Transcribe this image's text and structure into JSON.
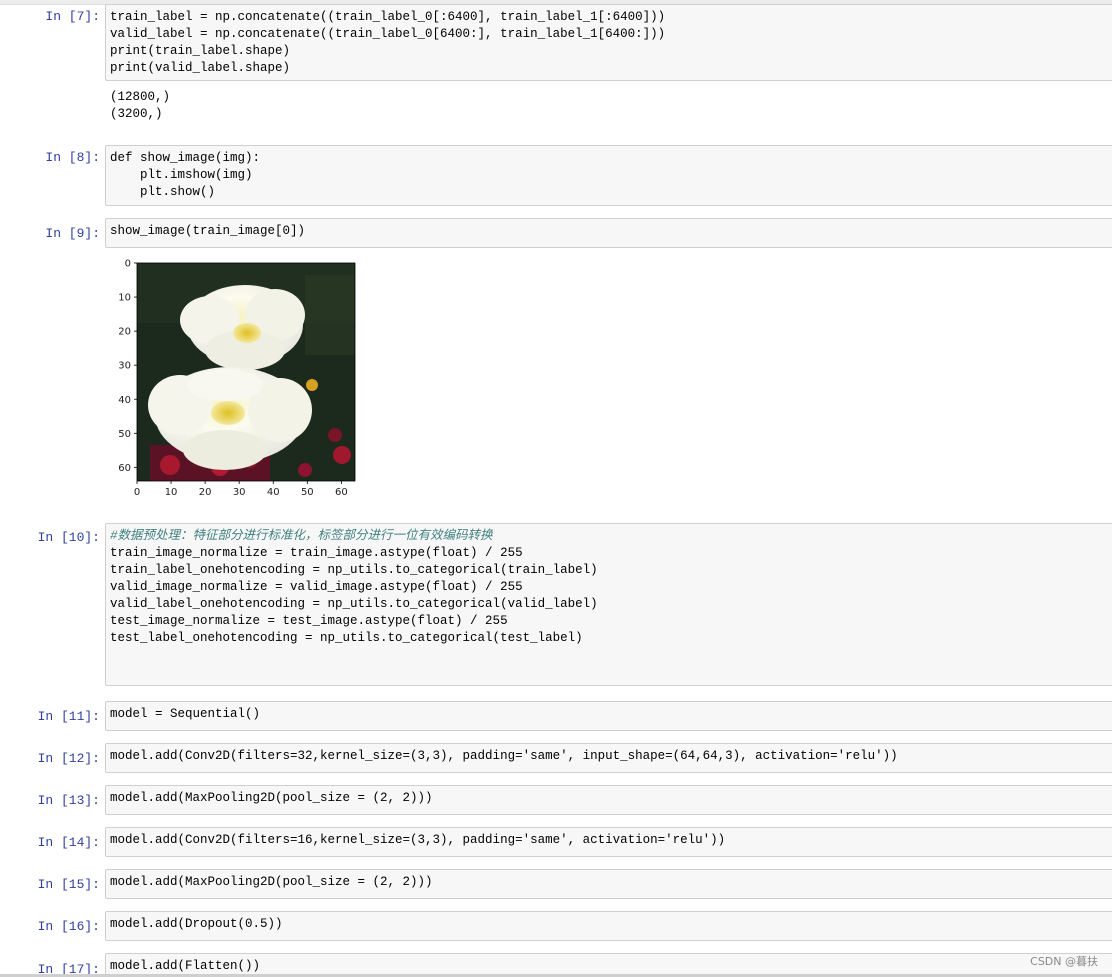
{
  "cells": [
    {
      "prompt": "In  [7]:",
      "code": [
        "train_label = np.concatenate((train_label_0[:6400], train_label_1[:6400]))",
        "valid_label = np.concatenate((train_label_0[6400:], train_label_1[6400:]))",
        "print(train_label.shape)",
        "print(valid_label.shape)"
      ],
      "output": [
        "(12800,)",
        "(3200,)"
      ]
    },
    {
      "prompt": "In  [8]:",
      "code": [
        "def show_image(img):",
        "    plt.imshow(img)",
        "    plt.show()"
      ]
    },
    {
      "prompt": "In  [9]:",
      "code": [
        "show_image(train_image[0])"
      ]
    },
    {
      "prompt": "In [10]:",
      "code": [
        "#数据预处理：特征部分进行标准化，标签部分进行一位有效编码转换",
        "train_image_normalize = train_image.astype(float) / 255",
        "train_label_onehotencoding = np_utils.to_categorical(train_label)",
        "",
        "valid_image_normalize = valid_image.astype(float) / 255",
        "valid_label_onehotencoding = np_utils.to_categorical(valid_label)",
        "",
        "test_image_normalize = test_image.astype(float) / 255",
        "test_label_onehotencoding = np_utils.to_categorical(test_label)"
      ]
    },
    {
      "prompt": "In [11]:",
      "code": [
        "model = Sequential()"
      ]
    },
    {
      "prompt": "In [12]:",
      "code": [
        "model.add(Conv2D(filters=32,kernel_size=(3,3), padding='same', input_shape=(64,64,3), activation='relu'))"
      ]
    },
    {
      "prompt": "In [13]:",
      "code": [
        "model.add(MaxPooling2D(pool_size = (2, 2)))"
      ]
    },
    {
      "prompt": "In [14]:",
      "code": [
        "model.add(Conv2D(filters=16,kernel_size=(3,3), padding='same', activation='relu'))"
      ]
    },
    {
      "prompt": "In [15]:",
      "code": [
        "model.add(MaxPooling2D(pool_size = (2, 2)))"
      ]
    },
    {
      "prompt": "In [16]:",
      "code": [
        "model.add(Dropout(0.5))"
      ]
    },
    {
      "prompt": "In [17]:",
      "code": [
        "model.add(Flatten())"
      ]
    }
  ],
  "image_plot": {
    "x_ticks": [
      "0",
      "10",
      "20",
      "30",
      "40",
      "50",
      "60"
    ],
    "y_ticks": [
      "0",
      "10",
      "20",
      "30",
      "40",
      "50",
      "60"
    ],
    "xlim": [
      0,
      64
    ],
    "ylim": [
      64,
      0
    ],
    "image_description_icon": "flower-image"
  },
  "watermark": "CSDN @暮扶"
}
